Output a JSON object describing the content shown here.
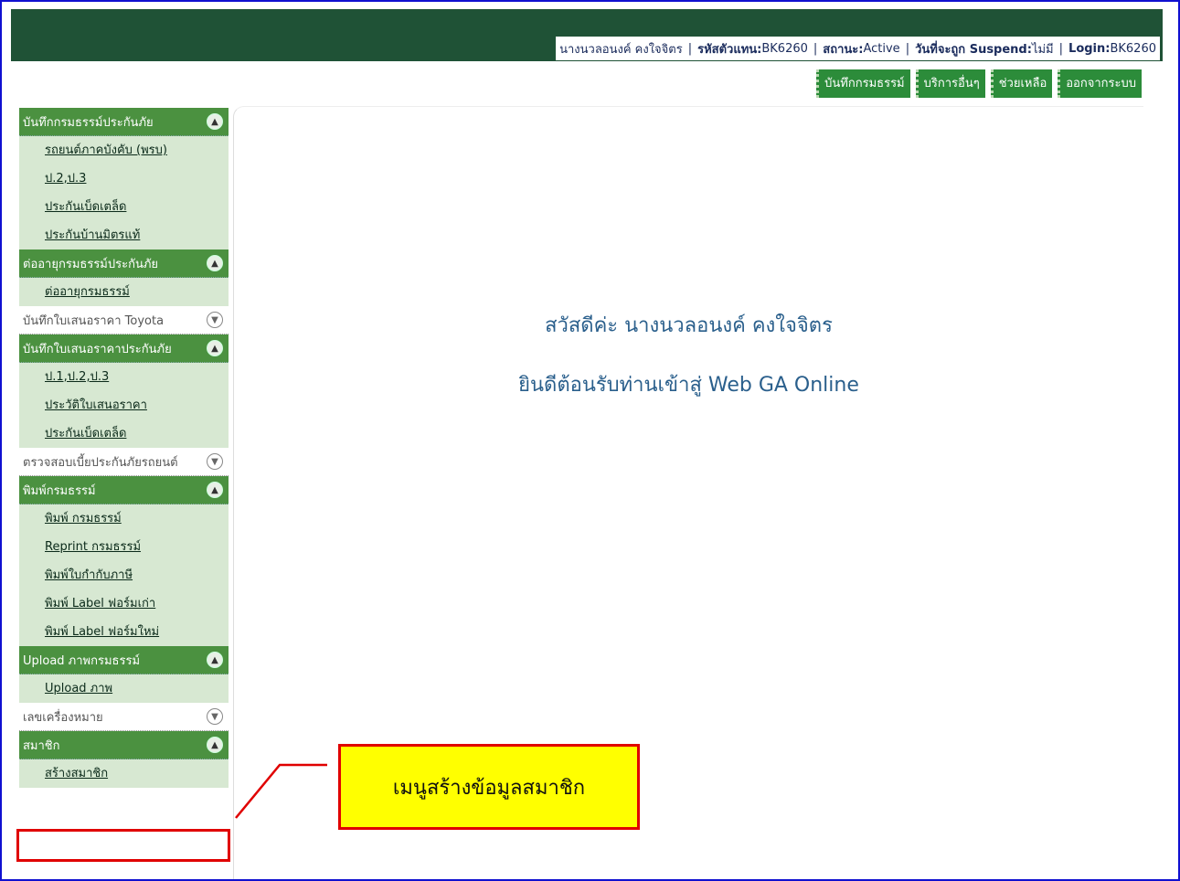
{
  "header": {
    "user_name": "นางนวลอนงค์ คงใจจิตร",
    "sep": "|",
    "agent_code_label": "รหัสตัวแทน:",
    "agent_code": "BK6260",
    "status_label": "สถานะ:",
    "status_value": "Active",
    "suspend_label": "วันที่จะถูก Suspend:",
    "suspend_value": "ไม่มี",
    "login_label": "Login:",
    "login_value": "BK6260"
  },
  "topnav": [
    "บันทึกกรมธรรม์",
    "บริการอื่นๆ",
    "ช่วยเหลือ",
    "ออกจากระบบ"
  ],
  "sidebar": {
    "sections": [
      {
        "title": "บันทึกกรมธรรม์ประกันภัย",
        "items": [
          "รถยนต์ภาคบังคับ (พรบ)",
          "ป.2,ป.3",
          "ประกันเบ็ดเตล็ด",
          "ประกันบ้านมิตรแท้"
        ]
      },
      {
        "title": "ต่ออายุกรมธรรม์ประกันภัย",
        "items": [
          "ต่ออายุกรมธรรม์"
        ]
      },
      {
        "title": "บันทึกใบเสนอราคา Toyota"
      },
      {
        "title": "บันทึกใบเสนอราคาประกันภัย",
        "items": [
          "ป.1,ป.2,ป.3",
          "ประวัติใบเสนอราคา",
          "ประกันเบ็ดเตล็ด"
        ]
      },
      {
        "title": "ตรวจสอบเบี้ยประกันภัยรถยนต์"
      },
      {
        "title": "พิมพ์กรมธรรม์",
        "items": [
          "พิมพ์ กรมธรรม์",
          "Reprint กรมธรรม์",
          "พิมพ์ใบกำกับภาษี",
          "พิมพ์ Label ฟอร์มเก่า",
          "พิมพ์ Label ฟอร์มใหม่"
        ]
      },
      {
        "title": "Upload ภาพกรมธรรม์",
        "items": [
          "Upload ภาพ"
        ]
      },
      {
        "title": "เลขเครื่องหมาย"
      },
      {
        "title": "สมาชิก",
        "items": [
          "สร้างสมาชิก"
        ]
      }
    ]
  },
  "main": {
    "greeting": "สวัสดีค่ะ นางนวลอนงค์ คงใจจิตร",
    "welcome": "ยินดีต้อนรับท่านเข้าสู่ Web GA Online"
  },
  "callout": {
    "text": "เมนูสร้างข้อมูลสมาชิก"
  },
  "colors": {
    "header_bg": "#1f5236",
    "nav_btn": "#2c8c3a",
    "section_active": "#4b9140",
    "menu_bg": "#d7e8d2",
    "callout_bg": "#ffff00",
    "highlight": "#e00000"
  }
}
